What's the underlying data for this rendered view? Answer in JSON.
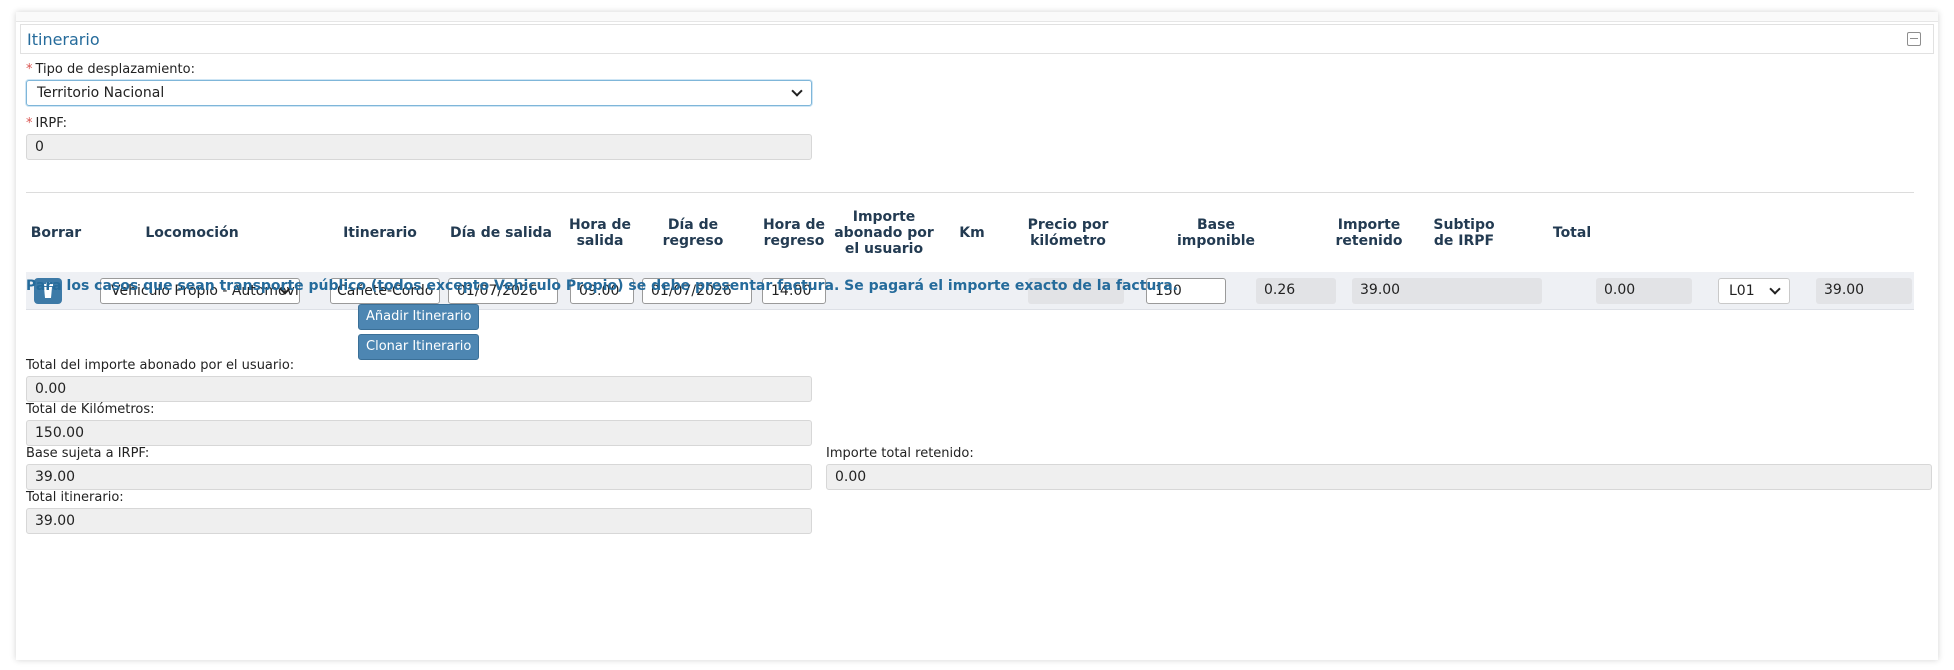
{
  "panel": {
    "title": "Itinerario",
    "collapse_icon": "minus-box-icon"
  },
  "form": {
    "tipo_label": "Tipo de desplazamiento:",
    "tipo_value": "Territorio Nacional",
    "irpf_label": "IRPF:",
    "irpf_value": "0",
    "required_mark": "*"
  },
  "table": {
    "headers": {
      "borrar": "Borrar",
      "locomocion": "Locomoción",
      "itinerario": "Itinerario",
      "dia_salida": "Día de salida",
      "hora_salida": "Hora de salida",
      "dia_regreso": "Día de regreso",
      "hora_regreso": "Hora de regreso",
      "importe_abonado": "Importe abonado por el usuario",
      "km": "Km",
      "precio_km": "Precio por kilómetro",
      "base_imponible": "Base imponible",
      "importe_retenido": "Importe retenido",
      "subtipo_irpf": "Subtipo de IRPF",
      "total": "Total"
    },
    "row": {
      "delete_icon": "trash-icon",
      "locomocion": "Vehiculo Propio - Automóvil",
      "itinerario": "Cañete-Córdo",
      "dia_salida": "01/07/2026",
      "hora_salida": "09:00",
      "dia_regreso": "01/07/2026",
      "hora_regreso": "14:00",
      "importe_abonado": "",
      "km": "150",
      "precio_km": "0.26",
      "base_imponible": "39.00",
      "importe_retenido": "0.00",
      "subtipo_irpf": "L01",
      "total": "39.00"
    }
  },
  "info_text": "Para los casos que sean transporte público (todos excepto Vehiculo Propio) se debe presentar factura. Se pagará el importe exacto de la factura.",
  "buttons": {
    "add": "Añadir Itinerario",
    "clone": "Clonar Itinerario"
  },
  "totals": {
    "importe_abonado_label": "Total del importe abonado por el usuario:",
    "importe_abonado_value": "0.00",
    "km_label": "Total de Kilómetros:",
    "km_value": "150.00",
    "base_label": "Base sujeta a IRPF:",
    "base_value": "39.00",
    "retenido_label": "Importe total retenido:",
    "retenido_value": "0.00",
    "itinerario_label": "Total itinerario:",
    "itinerario_value": "39.00"
  },
  "colors": {
    "accent": "#256b9b",
    "button": "#4d86b2",
    "required": "#d9534f"
  }
}
